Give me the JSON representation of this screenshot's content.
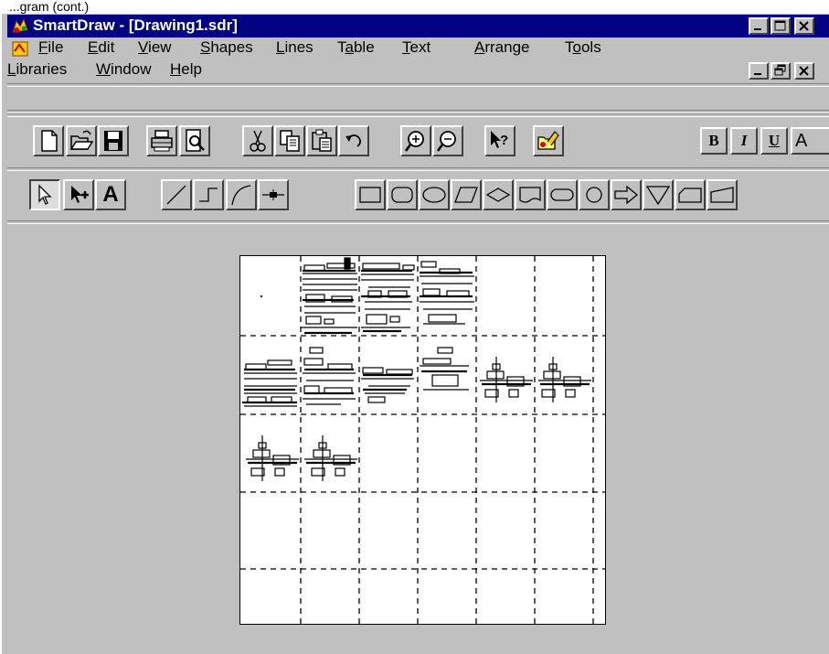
{
  "caption": "...gram (cont.)",
  "window": {
    "title": "SmartDraw - [Drawing1.sdr]",
    "controls": [
      "_",
      "□",
      "×"
    ]
  },
  "menubar": {
    "row1": [
      {
        "label": "File",
        "accel": "F"
      },
      {
        "label": "Edit",
        "accel": "E"
      },
      {
        "label": "View",
        "accel": "V"
      },
      {
        "label": "Shapes",
        "accel": "S"
      },
      {
        "label": "Lines",
        "accel": "L"
      },
      {
        "label": "Table",
        "accel": "a"
      },
      {
        "label": "Text",
        "accel": "T"
      },
      {
        "label": "Arrange",
        "accel": "A"
      },
      {
        "label": "Tools",
        "accel": "o"
      }
    ],
    "row2": [
      {
        "label": "Libraries",
        "accel": "L"
      },
      {
        "label": "Window",
        "accel": "W"
      },
      {
        "label": "Help",
        "accel": "H"
      }
    ],
    "doc_controls": [
      "_",
      "🗗",
      "×"
    ]
  },
  "toolbar_standard": {
    "buttons": [
      "new-icon",
      "open-icon",
      "save-icon",
      "print-icon",
      "print-preview-icon",
      "cut-icon",
      "copy-icon",
      "paste-icon",
      "undo-icon",
      "zoom-in-icon",
      "zoom-out-icon",
      "context-help-icon",
      "library-icon"
    ],
    "format_buttons": {
      "bold": "B",
      "italic": "I",
      "underline": "U",
      "font": "A"
    }
  },
  "toolbar_drawing": {
    "tools": [
      "pointer-icon",
      "point-insert-icon",
      "text-tool-icon",
      "line-icon",
      "elbow-line-icon",
      "curve-line-icon",
      "connector-icon",
      "rectangle-icon",
      "rounded-rectangle-icon",
      "ellipse-icon",
      "parallelogram-icon",
      "diamond-icon",
      "document-shape-icon",
      "terminator-icon",
      "circle-icon",
      "arrow-right-icon",
      "triangle-down-icon",
      "card-icon",
      "manual-input-icon"
    ],
    "text_tool_label": "A"
  },
  "page_view": {
    "columns": 6,
    "rows": 5,
    "description": "print page grid with flowchart thumbnails"
  },
  "colors": {
    "titlebar": "#000080",
    "chrome": "#c0c0c0",
    "page": "#ffffff"
  }
}
